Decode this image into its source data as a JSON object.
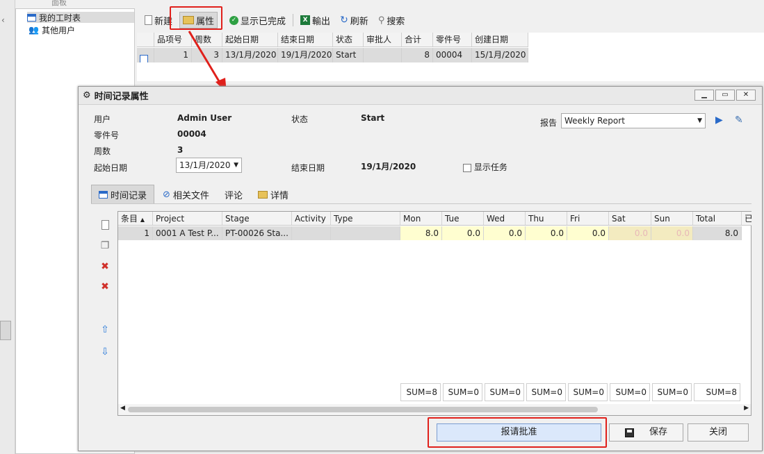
{
  "panel_label": "面板",
  "tree": {
    "items": [
      {
        "label": "我的工时表",
        "icon": "timesheet-icon"
      },
      {
        "label": "其他用户",
        "icon": "users-icon"
      }
    ]
  },
  "toolbar": {
    "new_label": "新建",
    "properties_label": "属性",
    "show_completed_label": "显示已完成",
    "export_label": "輸出",
    "refresh_label": "刷新",
    "search_label": "搜索"
  },
  "timesheet_grid": {
    "columns": [
      "品项号",
      "周数",
      "起始日期",
      "结束日期",
      "状态",
      "审批人",
      "合计",
      "零件号",
      "创建日期"
    ],
    "rows": [
      {
        "item": "1",
        "week": "3",
        "start": "13/1月/2020",
        "end": "19/1月/2020",
        "status": "Start",
        "approver": "",
        "total": "8",
        "part": "00004",
        "created": "15/1月/2020"
      }
    ]
  },
  "dialog": {
    "title": "时间记录属性",
    "fields": {
      "user_label": "用户",
      "user_value": "Admin User",
      "status_label": "状态",
      "status_value": "Start",
      "part_label": "零件号",
      "part_value": "00004",
      "week_label": "周数",
      "week_value": "3",
      "start_label": "起始日期",
      "start_value": "13/1月/2020",
      "end_label": "结束日期",
      "end_value": "19/1月/2020",
      "show_tasks_label": "显示任务",
      "report_label": "报告",
      "report_value": "Weekly Report"
    },
    "tabs": [
      "时间记录",
      "相关文件",
      "评论",
      "详情"
    ],
    "entries_grid": {
      "columns": [
        "条目",
        "Project",
        "Stage",
        "Activity",
        "Type",
        "Mon",
        "Tue",
        "Wed",
        "Thu",
        "Fri",
        "Sat",
        "Sun",
        "Total",
        "已"
      ],
      "rows": [
        {
          "entry": "1",
          "project": "0001 A Test P...",
          "stage": "PT-00026 Sta...",
          "activity": "",
          "type": "",
          "mon": "8.0",
          "tue": "0.0",
          "wed": "0.0",
          "thu": "0.0",
          "fri": "0.0",
          "sat": "0.0",
          "sun": "0.0",
          "total": "8.0"
        }
      ],
      "sums": [
        "SUM=8",
        "SUM=0",
        "SUM=0",
        "SUM=0",
        "SUM=0",
        "SUM=0",
        "SUM=0",
        "SUM=8"
      ]
    },
    "buttons": {
      "submit_label": "报请批准",
      "save_label": "保存",
      "close_label": "关闭"
    }
  },
  "colors": {
    "highlight": "#e0201b",
    "selected_row": "#dcdcdc",
    "weekday_cell": "#fffed0"
  }
}
